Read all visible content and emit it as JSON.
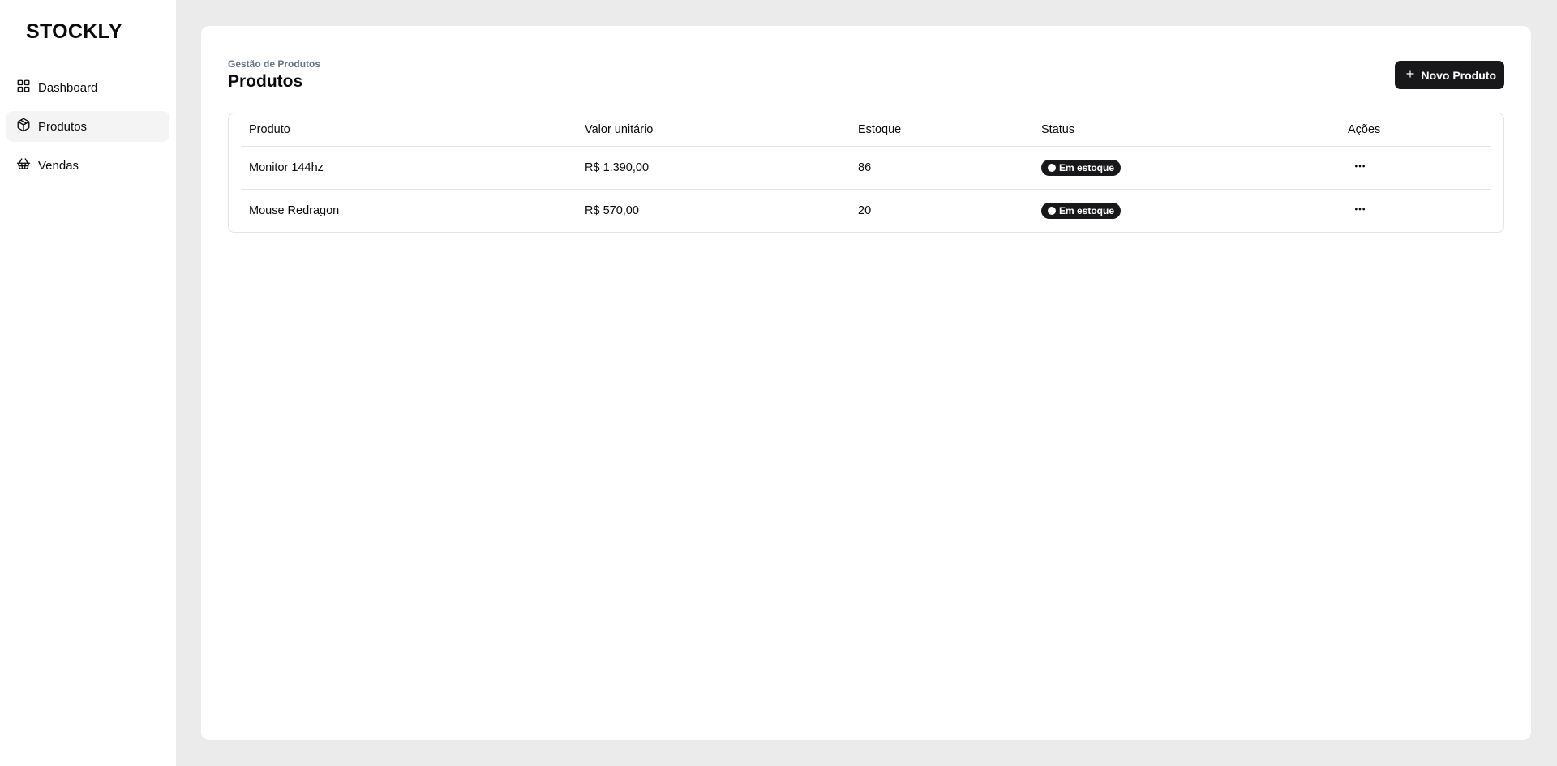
{
  "app": {
    "logo": "STOCKLY"
  },
  "sidebar": {
    "items": [
      {
        "label": "Dashboard",
        "icon": "layout-grid-icon",
        "active": false
      },
      {
        "label": "Produtos",
        "icon": "package-icon",
        "active": true
      },
      {
        "label": "Vendas",
        "icon": "shopping-basket-icon",
        "active": false
      }
    ]
  },
  "header": {
    "breadcrumb": "Gestão de Produtos",
    "title": "Produtos",
    "new_button_label": "Novo Produto",
    "new_button_icon": "plus-icon"
  },
  "table": {
    "columns": [
      "Produto",
      "Valor unitário",
      "Estoque",
      "Status",
      "Ações"
    ],
    "rows": [
      {
        "produto": "Monitor 144hz",
        "valor": "R$ 1.390,00",
        "estoque": "86",
        "status": "Em estoque"
      },
      {
        "produto": "Mouse Redragon",
        "valor": "R$ 570,00",
        "estoque": "20",
        "status": "Em estoque"
      }
    ]
  },
  "colors": {
    "primary": "#18181b",
    "page_background": "#ebebeb",
    "muted_text": "#64748b",
    "border": "#e4e4e7"
  }
}
